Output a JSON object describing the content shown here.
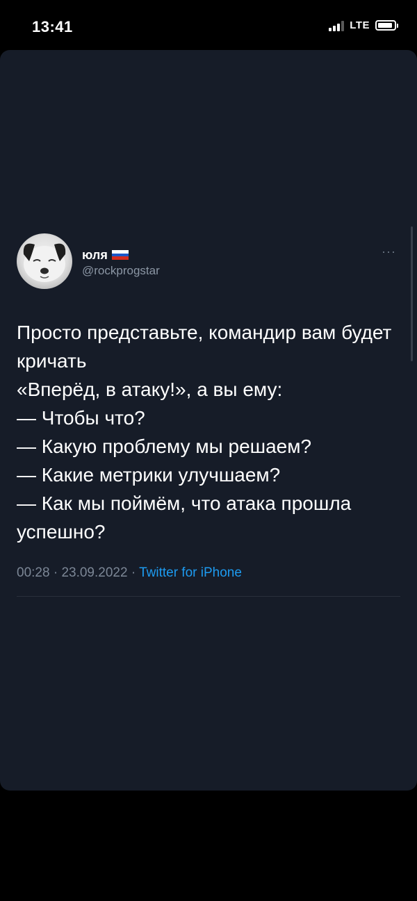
{
  "status_bar": {
    "time": "13:41",
    "network": "LTE"
  },
  "tweet": {
    "display_name": "юля",
    "username": "@rockprogstar",
    "more_label": "···",
    "text": "Просто представьте, командир вам будет кричать\n«Вперёд, в атаку!», а вы ему:\n— Чтобы что?\n— Какую проблему мы решаем?\n— Какие метрики улучшаем?\n— Как мы поймём, что атака прошла успешно?",
    "time": "00:28",
    "date": "23.09.2022",
    "separator": "·",
    "source": "Twitter for iPhone"
  },
  "colors": {
    "background": "#000000",
    "card": "#161c28",
    "link": "#1d9bf0",
    "muted": "#8b96a4"
  },
  "icons": {
    "flag": "russia-flag-icon",
    "more": "more-horizontal-icon",
    "signal": "cellular-signal-icon",
    "battery": "battery-icon"
  }
}
